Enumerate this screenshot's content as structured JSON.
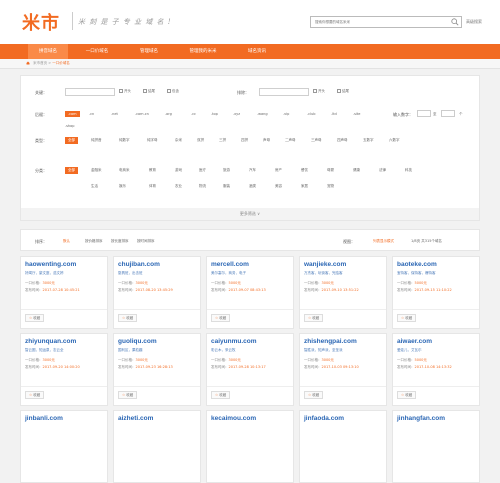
{
  "header": {
    "logo": "米市",
    "slogan": "米 刻 是 子 专 业 域 名 !",
    "search_placeholder": "搜索你想要的域名米米",
    "advanced_search": "高级搜索"
  },
  "nav": {
    "items": [
      "拼音域名",
      "一口价域名",
      "管理域名",
      "管理我的米米",
      "域名资讯"
    ]
  },
  "breadcrumb": {
    "home": "米市首页",
    "current": "一口价域名"
  },
  "filters": {
    "keyword_label": "关键：",
    "keyword_checks": [
      "开头",
      "结尾",
      "包含"
    ],
    "exclude_label": "排除：",
    "exclude_checks": [
      "开头",
      "结尾"
    ],
    "suffix_label": "后缀：",
    "suffix_options": [
      ".com",
      ".cn",
      ".net",
      ".com.cn",
      ".org",
      ".cc",
      ".top",
      ".xyz",
      ".wang",
      ".vip",
      ".club",
      ".ltd",
      ".site",
      ".shop"
    ],
    "suffix_active": ".com",
    "length_label": "输入数字：",
    "length_extra": [
      "个",
      "至",
      "个"
    ],
    "type_label": "类型：",
    "type_options": [
      "全部",
      "纯拼音",
      "纯数字",
      "纯字母",
      "杂米",
      "双拼",
      "三拼",
      "四拼",
      "声母",
      "二声母",
      "三声母",
      "四声母",
      "五数字",
      "六数字"
    ],
    "type_active": "全部",
    "category_label": "分类：",
    "category_options": [
      "全部",
      "金融米",
      "电商米",
      "教育",
      "游戏",
      "医疗",
      "旅游",
      "汽车",
      "房产",
      "餐饮",
      "母婴",
      "健康",
      "法律",
      "科技",
      "生活",
      "娱乐",
      "体育",
      "农业",
      "物流",
      "服装",
      "酒类",
      "美容",
      "家居",
      "宠物"
    ],
    "category_active": "全部",
    "more_label": "更多筛选 ∨"
  },
  "results": {
    "sort_label": "排序：",
    "sort_options": [
      "默认",
      "按价格排序",
      "按长度排序",
      "按时间排序"
    ],
    "sort_active": "默认",
    "view_label": "视图：",
    "right_links": [
      "列表显示模式",
      "1/8页 共315个域名"
    ]
  },
  "cards": [
    {
      "domain": "haowenting.com",
      "meaning": "好闻厅，豪文庭，浩文婷",
      "price": "3000元",
      "date": "2017-07-28 10:45:21",
      "fav": "收藏"
    },
    {
      "domain": "chujiban.com",
      "meaning": "厨具班，出击班",
      "price": "3000元",
      "date": "2017-08-20 13:45:29",
      "fav": "收藏"
    },
    {
      "domain": "mercell.com",
      "meaning": "美尔塞尔，商务，电子",
      "price": "5000元",
      "date": "2017-09-07 08:43:13",
      "fav": "收藏"
    },
    {
      "domain": "wanjieke.com",
      "meaning": "万杰客，玩街客，完结客",
      "price": "3000元",
      "date": "2017-09-10 13:51:22",
      "fav": "收藏"
    },
    {
      "domain": "baoteke.com",
      "meaning": "宝特客，保特客，爆特客",
      "price": "5000元",
      "date": "2017-09-15 11:10:22",
      "fav": "收藏"
    },
    {
      "domain": "zhiyunquan.com",
      "meaning": "智云圈，知运泉，志云全",
      "price": "3000元",
      "date": "2017-09-20 14:00:20",
      "fav": "收藏"
    },
    {
      "domain": "guoliqu.com",
      "meaning": "国利区，果粒趣",
      "price": "3000元",
      "date": "2017-09-23 16:28:13",
      "fav": "收藏"
    },
    {
      "domain": "caiyunmu.com",
      "meaning": "彩云木，采云牧",
      "price": "3000元",
      "date": "2017-09-28 10:13:17",
      "fav": "收藏"
    },
    {
      "domain": "zhishengpai.com",
      "meaning": "智胜派，知声派，至圣派",
      "price": "3000元",
      "date": "2017-10-03 09:13:10",
      "fav": "收藏"
    },
    {
      "domain": "aiwaer.com",
      "meaning": "爱娃儿，艾瓦尔",
      "price": "5000元",
      "date": "2017-10-08 14:13:32",
      "fav": "收藏"
    },
    {
      "domain": "jinbanli.com"
    },
    {
      "domain": "aizheti.com"
    },
    {
      "domain": "kecaimou.com"
    },
    {
      "domain": "jinfaoda.com"
    },
    {
      "domain": "jinhangfan.com"
    }
  ],
  "card_labels": {
    "price_label": "一口价格：",
    "date_label": "发布时间："
  },
  "colors": {
    "brand": "#f26b22",
    "link": "#2a66b4"
  }
}
